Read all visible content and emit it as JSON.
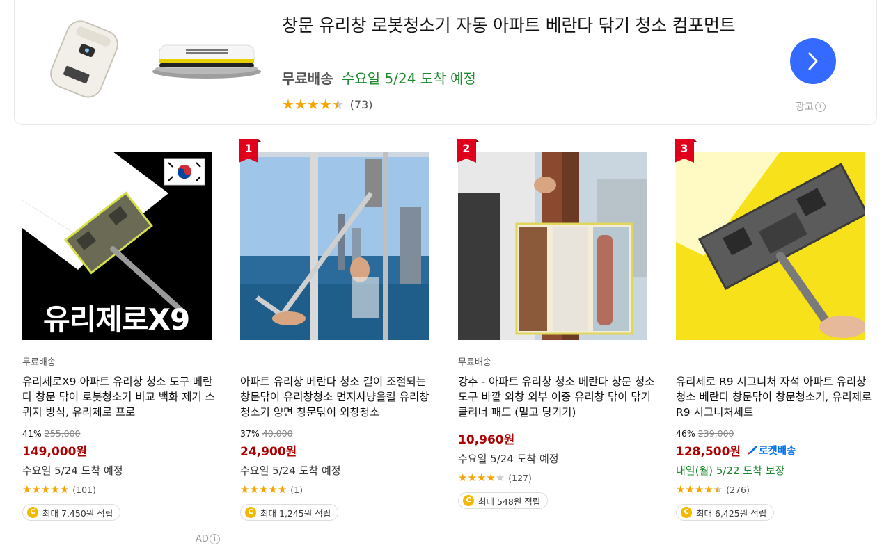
{
  "banner": {
    "title": "창문 유리창 로봇청소기 자동 아파트 베란다 닦기 청소 컴포먼트",
    "free_shipping": "무료배송",
    "arrival": "수요일 5/24 도착 예정",
    "rating": 4.5,
    "stars_text": "★★★★★",
    "review_count": "(73)",
    "ad_label": "광고",
    "next_icon": "chevron-right-icon"
  },
  "products": [
    {
      "rank": "",
      "thumb_text": "유리제로X9",
      "free_shipping": "무료배송",
      "name": "유리제로X9 아파트 유리창 청소 도구 베란다 창문 닦이 로봇청소기 비교 백화 제거 스퀴지 방식, 유리제로 프로",
      "discount_rate": "41%",
      "base_price": "255,000",
      "price": "149,000원",
      "rocket": "",
      "delivery": "수요일 5/24 도착 예정",
      "rating": 5,
      "review_count": "(101)",
      "points": "최대 7,450원 적립"
    },
    {
      "rank": "1",
      "free_shipping": "",
      "name": "아파트 유리창 베란다 청소 길이 조절되는 창문닦이 유리창청소 먼지사냥올킬 유리창청소기 양면 창문닦이 외창청소",
      "discount_rate": "37%",
      "base_price": "40,000",
      "price": "24,900원",
      "rocket": "",
      "delivery": "수요일 5/24 도착 예정",
      "rating": 5,
      "review_count": "(1)",
      "points": "최대 1,245원 적립"
    },
    {
      "rank": "2",
      "free_shipping": "무료배송",
      "name": "강추 - 아파트 유리창 청소 베란다 창문 청소 도구 바깥 외창 외부 이중 유리창 닦이 닦기 클리너 패드 (밀고 당기기)",
      "discount_rate": "",
      "base_price": "",
      "price": "10,960원",
      "rocket": "",
      "delivery": "수요일 5/24 도착 예정",
      "rating": 4,
      "review_count": "(127)",
      "points": "최대 548원 적립"
    },
    {
      "rank": "3",
      "free_shipping": "",
      "name": "유리제로 R9 시그니처 자석 아파트 유리창 청소 베란다 창문닦이 창문청소기, 유리제로R9 시그니처세트",
      "discount_rate": "46%",
      "base_price": "239,000",
      "price": "128,500원",
      "rocket": "로켓배송",
      "delivery": "내일(월) 5/22 도착 보장",
      "rating": 4.5,
      "review_count": "(276)",
      "points": "최대 6,425원 적립"
    }
  ],
  "bottom_ad_label": "AD",
  "colors": {
    "accent_blue": "#346aff",
    "price_red": "#ae0000",
    "arrival_green": "#1b8a2d",
    "star": "#f6a400",
    "rank_red": "#e0001b",
    "rocket_blue": "#0073e9"
  }
}
